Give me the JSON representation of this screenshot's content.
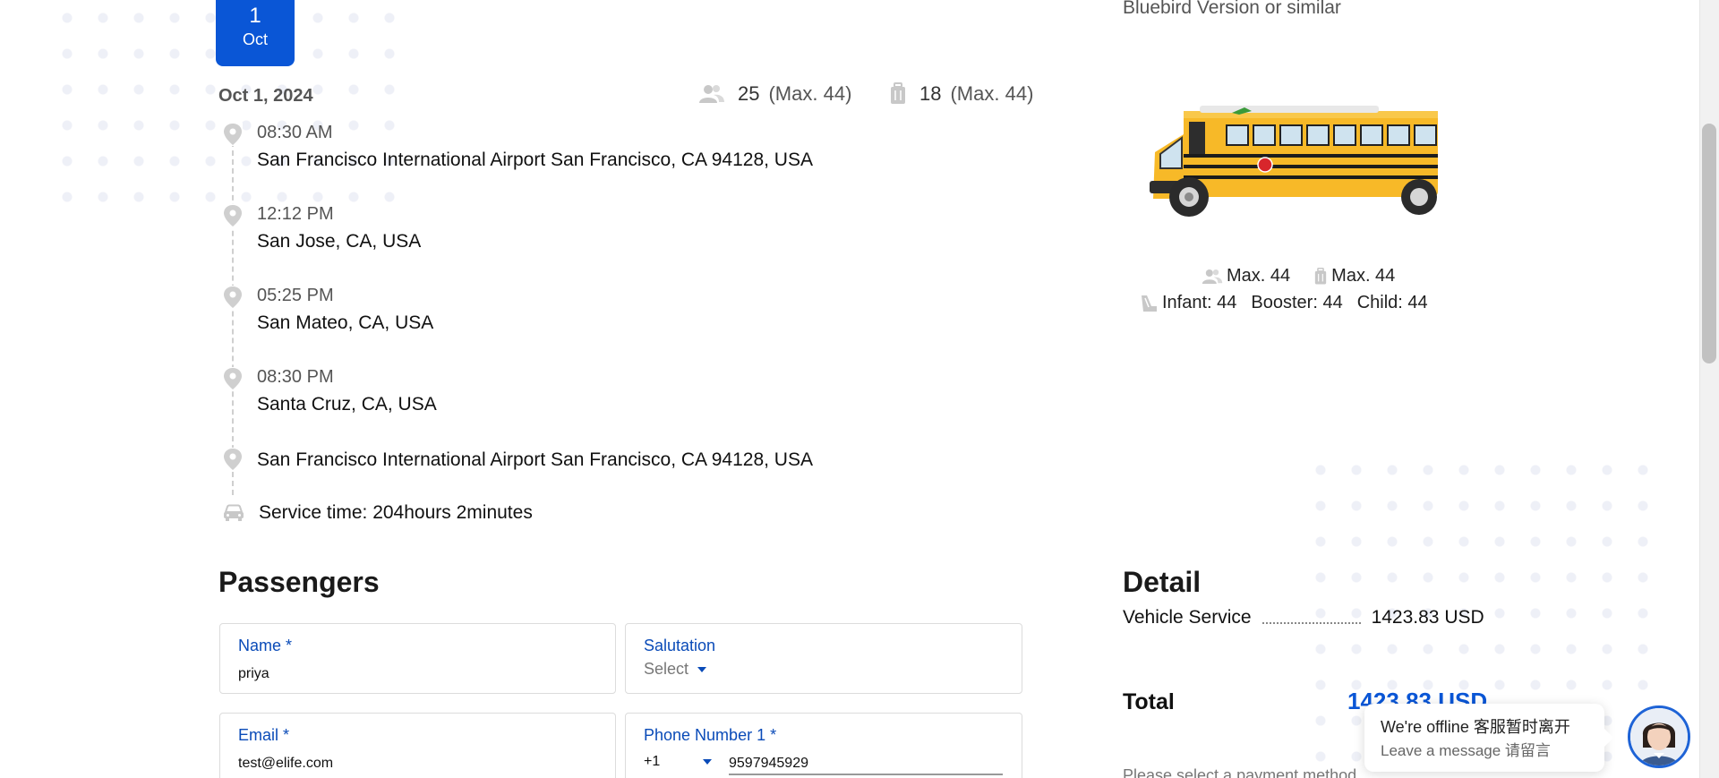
{
  "trip": {
    "badge": {
      "day": "1",
      "month": "Oct"
    },
    "date": "Oct 1, 2024",
    "passengers": {
      "count": "25",
      "max": "(Max. 44)"
    },
    "luggage": {
      "count": "18",
      "max": "(Max. 44)"
    },
    "stops": [
      {
        "time": "08:30 AM",
        "address": "San Francisco International Airport San Francisco, CA 94128, USA"
      },
      {
        "time": "12:12 PM",
        "address": "San Jose, CA, USA"
      },
      {
        "time": "05:25 PM",
        "address": "San Mateo, CA, USA"
      },
      {
        "time": "08:30 PM",
        "address": "Santa Cruz, CA, USA"
      },
      {
        "time": "",
        "address": "San Francisco International Airport San Francisco, CA 94128, USA"
      }
    ],
    "service_time": "Service time: 204hours 2minutes"
  },
  "vehicle": {
    "model": "Bluebird Version or similar",
    "max_passengers": "Max. 44",
    "max_luggage": "Max. 44",
    "infant": "Infant: 44",
    "booster": "Booster: 44",
    "child": "Child: 44"
  },
  "passengers_section": {
    "title": "Passengers",
    "name_label": "Name *",
    "name_value": "priya",
    "salutation_label": "Salutation",
    "salutation_value": "Select",
    "email_label": "Email *",
    "email_value": "test@elife.com",
    "phone_label": "Phone Number 1 *",
    "phone_code": "+1",
    "phone_value": "9597945929"
  },
  "detail": {
    "title": "Detail",
    "vehicle_service_label": "Vehicle Service",
    "vehicle_service_value": "1423.83 USD",
    "total_label": "Total",
    "total_value": "1423.83 USD",
    "payment_note": "Please select a payment method"
  },
  "chat": {
    "status": "We're offline 客服暂时离开",
    "prompt": "Leave a message 请留言"
  },
  "colors": {
    "accent": "#0a56d6",
    "label_blue": "#0a4bb8",
    "muted_text": "#555555"
  },
  "icons": {
    "passengers": "users-icon",
    "luggage": "luggage-icon",
    "stop": "map-pin-icon",
    "service": "car-icon",
    "seat": "child-seat-icon"
  }
}
